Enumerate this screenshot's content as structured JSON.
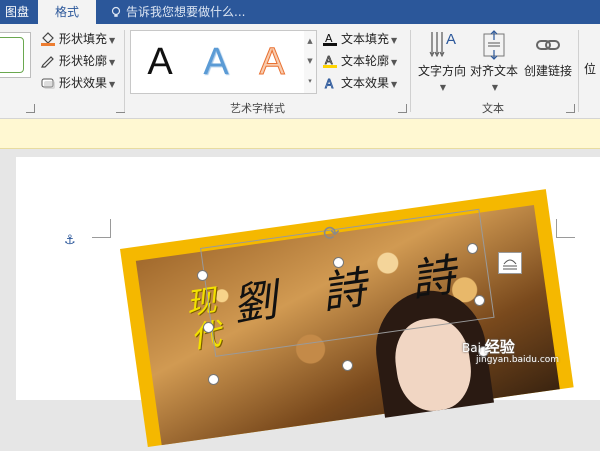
{
  "tabs": {
    "left_partial": "图盘",
    "active": "格式"
  },
  "tellme": {
    "text": "告诉我您想要做什么...",
    "icon": "lightbulb-icon"
  },
  "shape_styles": {
    "fill": "形状填充",
    "outline": "形状轮廓",
    "effects": "形状效果"
  },
  "wordart": {
    "group_label": "艺术字样式",
    "samples": [
      "A",
      "A",
      "A"
    ],
    "text_fill": "文本填充",
    "text_outline": "文本轮廓",
    "text_effects": "文本效果"
  },
  "text_group": {
    "label": "文本",
    "direction": "文字方向",
    "align": "对齐文本",
    "link": "创建链接",
    "partial": "位"
  },
  "document": {
    "calligraphy": "劉詩詩",
    "side_text": "现代"
  },
  "watermark": {
    "brand": "经验",
    "site": "Bai",
    "url": "jingyan.baidu.com"
  },
  "colors": {
    "accent": "#2b579a",
    "frame": "#f5b800",
    "infobar": "#fff8d2"
  }
}
